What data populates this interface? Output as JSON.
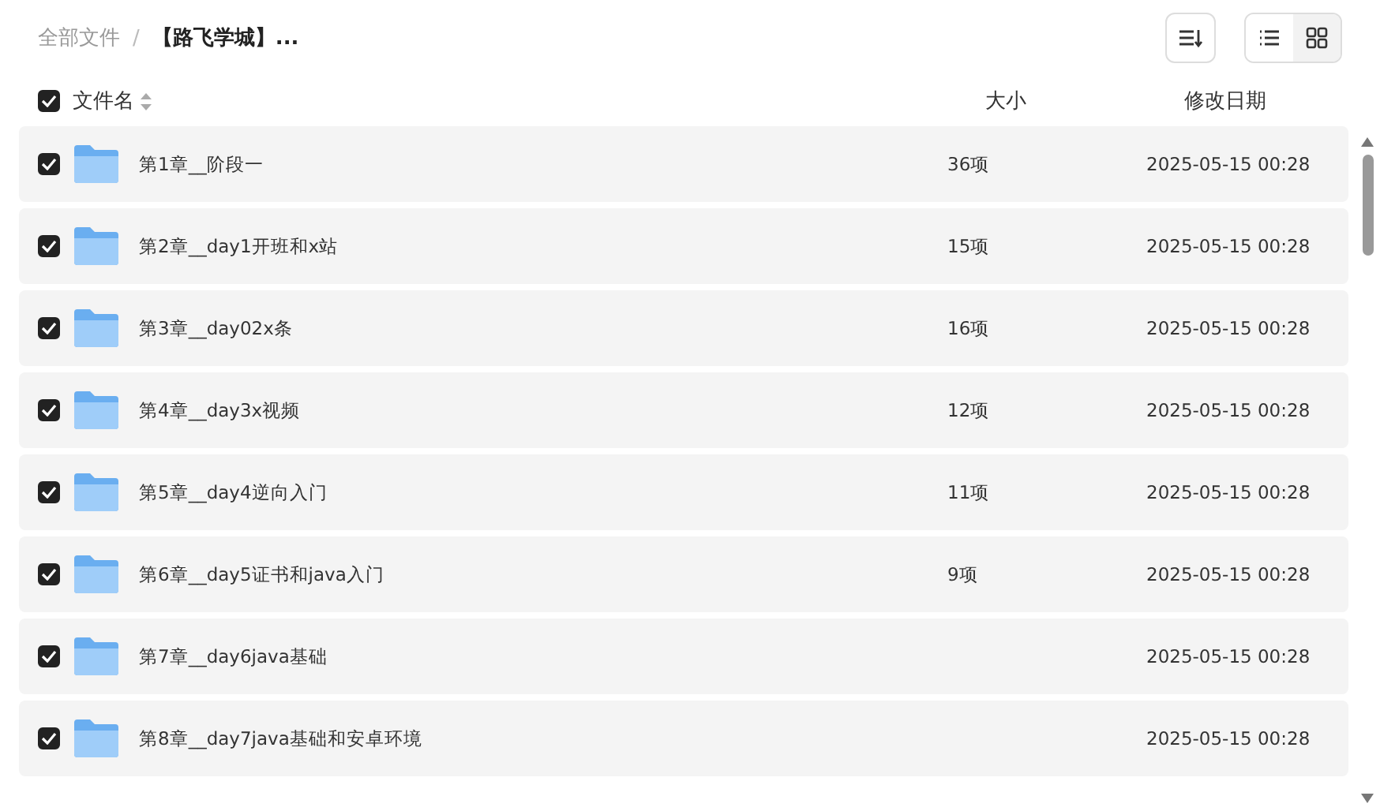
{
  "breadcrumb_separator": "/",
  "breadcrumb": [
    {
      "label": "全部文件",
      "current": false
    },
    {
      "label": "【路飞学城】...",
      "current": true
    }
  ],
  "toolbar": {
    "views": [
      {
        "kind": "list",
        "selected": true
      },
      {
        "kind": "grid",
        "selected": false
      }
    ]
  },
  "header": {
    "select_all": {
      "checked": true
    },
    "columns": [
      "文件名",
      "大小",
      "修改日期"
    ]
  },
  "rows": [
    {
      "name": "第1章__阶段一",
      "size": "36项",
      "modified": "2025-05-15 00:28",
      "checked": true
    },
    {
      "name": "第2章__day1开班和x站",
      "size": "15项",
      "modified": "2025-05-15 00:28",
      "checked": true
    },
    {
      "name": "第3章__day02x条",
      "size": "16项",
      "modified": "2025-05-15 00:28",
      "checked": true
    },
    {
      "name": "第4章__day3x视频",
      "size": "12项",
      "modified": "2025-05-15 00:28",
      "checked": true
    },
    {
      "name": "第5章__day4逆向入门",
      "size": "11项",
      "modified": "2025-05-15 00:28",
      "checked": true
    },
    {
      "name": "第6章__day5证书和java入门",
      "size": "9项",
      "modified": "2025-05-15 00:28",
      "checked": true
    },
    {
      "name": "第7章__day6java基础",
      "modified": "2025-05-15 00:28",
      "checked": true
    },
    {
      "name": "第8章__day7java基础和安卓环境",
      "modified": "2025-05-15 00:28",
      "checked": true
    }
  ]
}
